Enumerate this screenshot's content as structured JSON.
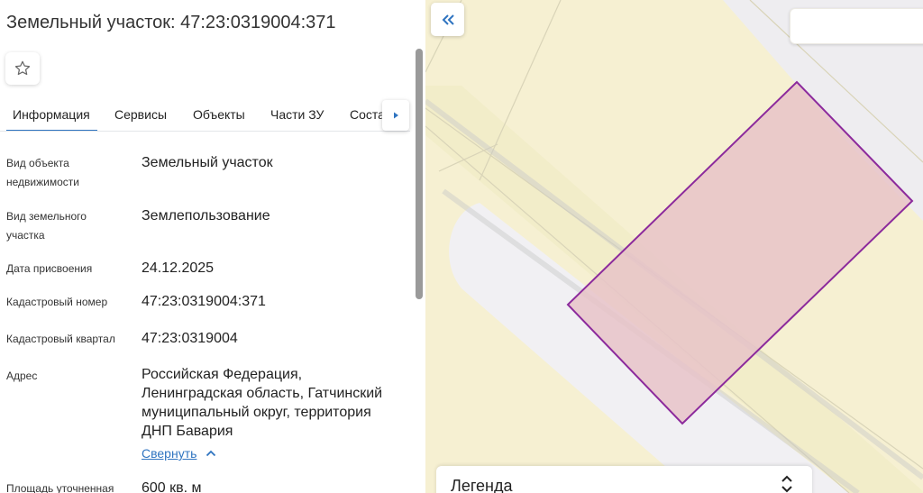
{
  "header": {
    "title": "Земельный участок: 47:23:0319004:371"
  },
  "tabs": [
    {
      "label": "Информация",
      "active": true
    },
    {
      "label": "Сервисы",
      "active": false
    },
    {
      "label": "Объекты",
      "active": false
    },
    {
      "label": "Части ЗУ",
      "active": false
    },
    {
      "label": "Соста",
      "active": false
    }
  ],
  "info": {
    "object_type": {
      "label_line1": "Вид объекта",
      "label_line2": "недвижимости",
      "value": "Земельный участок"
    },
    "land_type": {
      "label_line1": "Вид земельного",
      "label_line2": "участка",
      "value": "Землепользование"
    },
    "assign_date": {
      "label": "Дата присвоения",
      "value": "24.12.2025"
    },
    "cadastral_number": {
      "label": "Кадастровый номер",
      "value": "47:23:0319004:371"
    },
    "cadastral_quarter": {
      "label": "Кадастровый квартал",
      "value": "47:23:0319004"
    },
    "address": {
      "label": "Адрес",
      "line1": "Российская Федерация,",
      "line2": "Ленинградская область, Гатчинский",
      "line3": "муниципальный округ, территория",
      "line4": "ДНП Бавария"
    },
    "collapse_label": "Свернуть",
    "area": {
      "label": "Площадь уточненная",
      "value": "600 кв. м"
    }
  },
  "map": {
    "legend_title": "Легенда",
    "parcel_fill": "#e7c3c8",
    "parcel_stroke": "#8c2a9c",
    "base_fill": "#f6f0d2"
  },
  "colors": {
    "accent": "#2f74c0",
    "text": "#222222"
  },
  "icons": {
    "favorite": "star-outline-icon",
    "tabs_next": "triangle-right-icon",
    "collapse_link": "chevron-up-icon",
    "panel_toggle": "double-chevron-left-icon",
    "legend_toggle": "chevron-up-down-icon"
  }
}
